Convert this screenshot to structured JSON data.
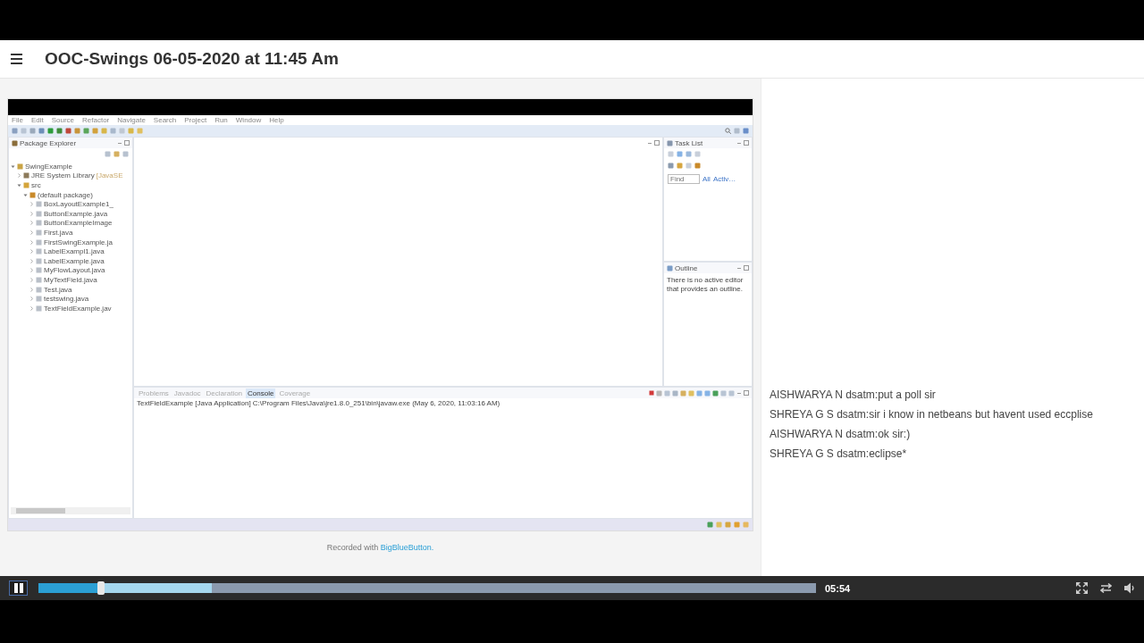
{
  "recording": {
    "title": "OOC-Swings 06-05-2020 at 11:45 Am"
  },
  "eclipse": {
    "menu": [
      "File",
      "Edit",
      "Source",
      "Refactor",
      "Navigate",
      "Search",
      "Project",
      "Run",
      "Window",
      "Help"
    ],
    "package_explorer": {
      "title": "Package Explorer",
      "tree": [
        {
          "label": "SwingExample",
          "kind": "project",
          "expanded": true,
          "children": [
            {
              "label": "JRE System Library",
              "suffix": "[JavaSE",
              "kind": "library",
              "expanded": false
            },
            {
              "label": "src",
              "kind": "folder",
              "expanded": true,
              "children": [
                {
                  "label": "(default package)",
                  "kind": "package",
                  "expanded": true,
                  "children": [
                    {
                      "label": "BoxLayoutExample1_",
                      "kind": "file",
                      "expanded": false
                    },
                    {
                      "label": "ButtonExample.java",
                      "kind": "file",
                      "expanded": false
                    },
                    {
                      "label": "ButtonExampleImage",
                      "kind": "file",
                      "expanded": false
                    },
                    {
                      "label": "First.java",
                      "kind": "file",
                      "expanded": false
                    },
                    {
                      "label": "FirstSwingExample.ja",
                      "kind": "file",
                      "expanded": false
                    },
                    {
                      "label": "LabelExampl1.java",
                      "kind": "file",
                      "expanded": false
                    },
                    {
                      "label": "LabelExample.java",
                      "kind": "file",
                      "expanded": false
                    },
                    {
                      "label": "MyFlowLayout.java",
                      "kind": "file",
                      "expanded": false
                    },
                    {
                      "label": "MyTextField.java",
                      "kind": "file",
                      "expanded": false
                    },
                    {
                      "label": "Test.java",
                      "kind": "file",
                      "expanded": false
                    },
                    {
                      "label": "testswing.java",
                      "kind": "file",
                      "expanded": false
                    },
                    {
                      "label": "TextFieldExample.jav",
                      "kind": "file",
                      "expanded": false
                    }
                  ]
                }
              ]
            }
          ]
        }
      ]
    },
    "task_list": {
      "title": "Task List",
      "find": {
        "placeholder": "Find"
      },
      "links": [
        "All",
        "Activ…"
      ]
    },
    "outline": {
      "title": "Outline",
      "message": "There is no active editor that provides an outline."
    },
    "console": {
      "tabs": [
        {
          "label": "Problems",
          "selected": false
        },
        {
          "label": "Javadoc",
          "selected": false
        },
        {
          "label": "Declaration",
          "selected": false
        },
        {
          "label": "Console",
          "selected": true
        },
        {
          "label": "Coverage",
          "selected": false
        }
      ],
      "output": "TextFieldExample [Java Application] C:\\Program Files\\Java\\jre1.8.0_251\\bin\\javaw.exe  (May 6, 2020, 11:03:16 AM)"
    }
  },
  "chat": [
    "AISHWARYA N dsatm:put a poll sir",
    "SHREYA G S dsatm:sir i know in netbeans but havent used eccplise",
    "AISHWARYA N dsatm:ok sir:)",
    "SHREYA G S dsatm:eclipse*"
  ],
  "footer": {
    "prefix": "Recorded with",
    "link": "BigBlueButton."
  },
  "player": {
    "playing": true,
    "progress": {
      "level": 0.081
    },
    "buffer": {
      "level": 0.223
    },
    "time": "05:54"
  }
}
